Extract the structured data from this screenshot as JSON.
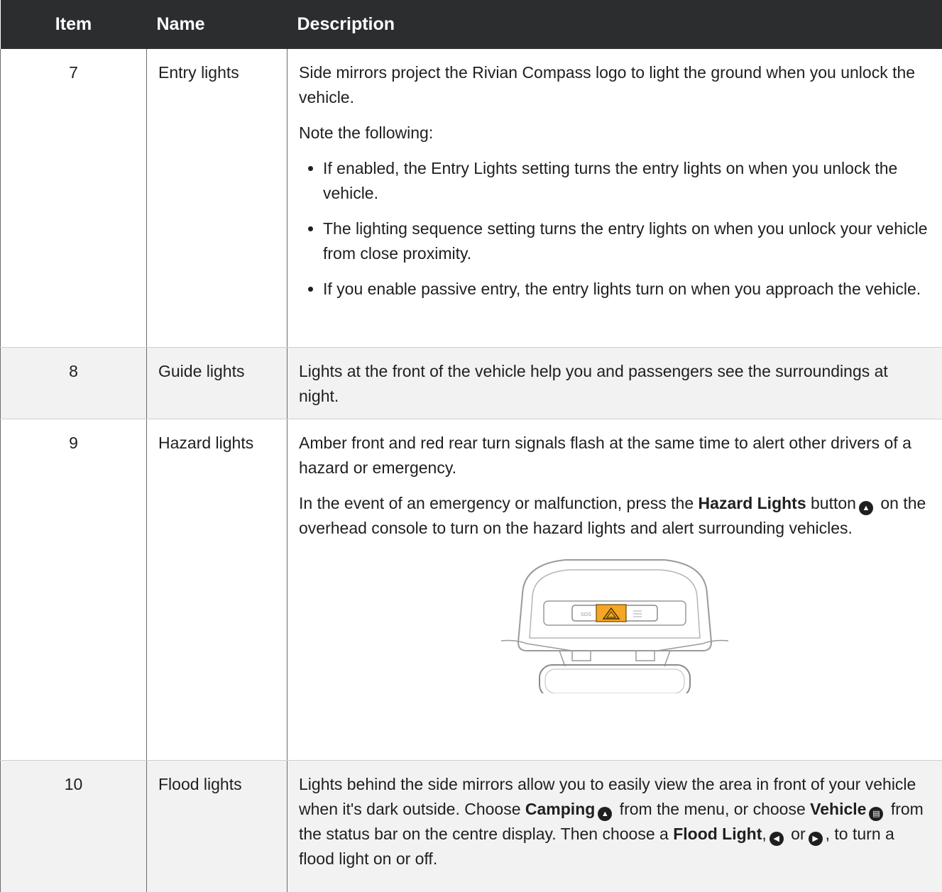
{
  "header": {
    "item": "Item",
    "name": "Name",
    "description": "Description"
  },
  "rows": [
    {
      "item": "7",
      "name": "Entry lights",
      "p1": "Side mirrors project the Rivian Compass logo to light the ground when you unlock the vehicle.",
      "p2": "Note the following:",
      "bullets": [
        "If enabled, the Entry Lights setting turns the entry lights on when you unlock the vehicle.",
        "The lighting sequence setting turns the entry lights on when you unlock your vehicle from close proximity.",
        "If you enable passive entry, the entry lights turn on when you approach the vehicle."
      ]
    },
    {
      "item": "8",
      "name": "Guide lights",
      "p1": "Lights at the front of the vehicle help you and passengers see the surroundings at night."
    },
    {
      "item": "9",
      "name": "Hazard lights",
      "p1": "Amber front and red rear turn signals flash at the same time to alert other drivers of a hazard or emergency.",
      "p2_a": "In the event of an emergency or malfunction, press the ",
      "p2_bold": "Hazard Lights",
      "p2_b": " button",
      "p2_c": " on the overhead console to turn on the hazard lights and alert surrounding vehicles.",
      "figure_label": "SOS"
    },
    {
      "item": "10",
      "name": "Flood lights",
      "p1_a": "Lights behind the side mirrors allow you to easily view the area in front of your vehicle when it's dark outside. Choose ",
      "p1_bold1": "Camping",
      "p1_b": " from the menu, or choose ",
      "p1_bold2": "Vehicle",
      "p1_c": " from the status bar on the centre display. Then choose a ",
      "p1_bold3": "Flood Light",
      "p1_d": ",",
      "p1_e": " or",
      "p1_f": ", to turn a flood light on or off."
    }
  ],
  "icons": [
    "hazard-icon",
    "camping-icon",
    "vehicle-icon",
    "flood-light-left-icon",
    "flood-light-right-icon"
  ],
  "colors": {
    "header_bg": "#2b2d2f",
    "shade_bg": "#f2f2f2",
    "hazard_amber": "#f5a623"
  }
}
